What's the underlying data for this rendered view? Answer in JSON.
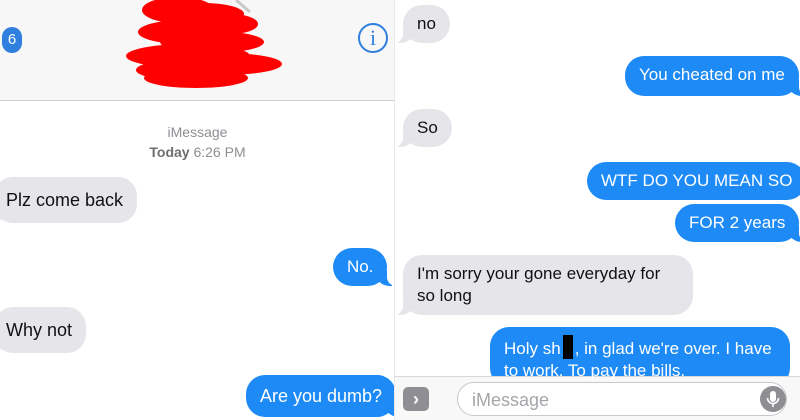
{
  "left": {
    "header": {
      "back_count": "6",
      "info_glyph": "i"
    },
    "timestamp": {
      "service": "iMessage",
      "day": "Today",
      "time": "6:26 PM"
    },
    "messages": [
      {
        "dir": "in",
        "text": "Plz come back"
      },
      {
        "dir": "out",
        "text": "No."
      },
      {
        "dir": "in",
        "text": "Why not"
      },
      {
        "dir": "out",
        "text": "Are you dumb?"
      }
    ]
  },
  "right": {
    "messages": [
      {
        "dir": "in",
        "text": "no"
      },
      {
        "dir": "out",
        "text": "You cheated on me"
      },
      {
        "dir": "in",
        "text": "So"
      },
      {
        "dir": "out",
        "text": "WTF DO YOU MEAN SO"
      },
      {
        "dir": "out",
        "text": "FOR 2 years"
      },
      {
        "dir": "in",
        "text": "I'm sorry your gone everyday for so long"
      },
      {
        "dir": "out",
        "text_before": "Holy sh",
        "text_after": ", in glad we're over. I have to work. To pay the bills."
      }
    ],
    "input": {
      "placeholder": "iMessage"
    }
  },
  "colors": {
    "incoming": "#e5e5ea",
    "outgoing": "#1d8af6",
    "accent": "#2f7fde"
  },
  "icons": {
    "back": "back-count-badge",
    "info": "info-icon",
    "apps": "apps-arrow-icon",
    "mic": "microphone-icon",
    "censor": "red-scribble-censor"
  }
}
